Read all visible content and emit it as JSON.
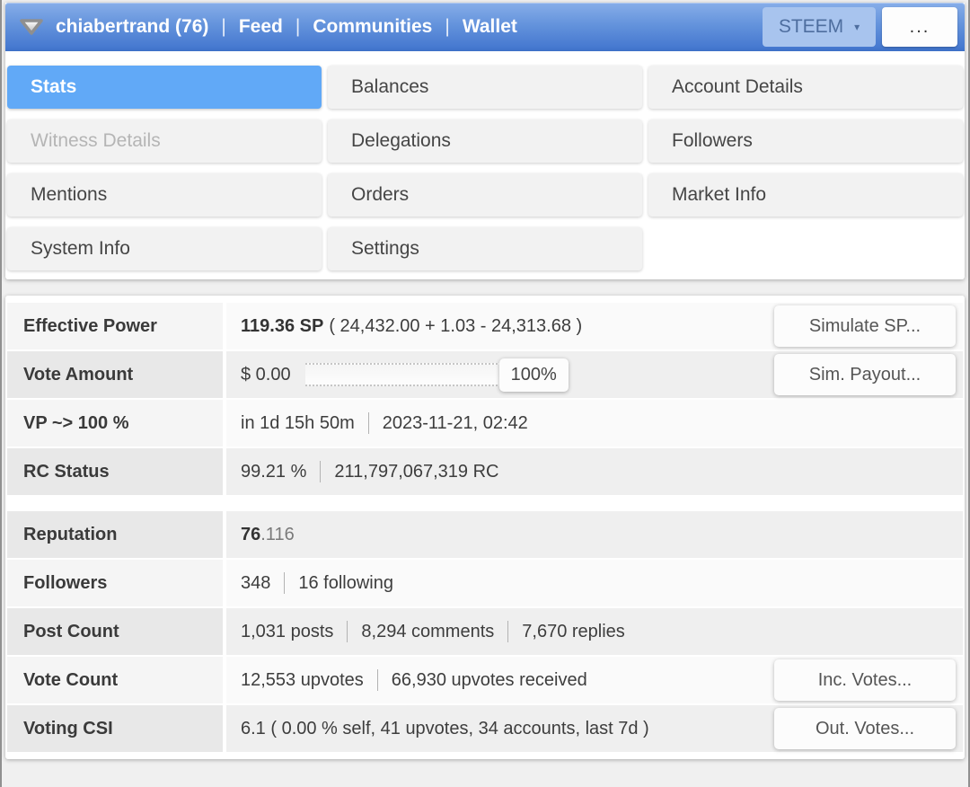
{
  "header": {
    "account": "chiabertrand (76)",
    "separator": "|",
    "nav": [
      {
        "label": "Feed"
      },
      {
        "label": "Communities"
      },
      {
        "label": "Wallet"
      }
    ],
    "currency": {
      "label": "STEEM",
      "caret": "▾"
    },
    "more_label": "..."
  },
  "tabs": [
    {
      "label": "Stats",
      "state": "active"
    },
    {
      "label": "Balances",
      "state": "normal"
    },
    {
      "label": "Account Details",
      "state": "normal"
    },
    {
      "label": "Witness Details",
      "state": "disabled"
    },
    {
      "label": "Delegations",
      "state": "normal"
    },
    {
      "label": "Followers",
      "state": "normal"
    },
    {
      "label": "Mentions",
      "state": "normal"
    },
    {
      "label": "Orders",
      "state": "normal"
    },
    {
      "label": "Market Info",
      "state": "normal"
    },
    {
      "label": "System Info",
      "state": "normal"
    },
    {
      "label": "Settings",
      "state": "normal"
    }
  ],
  "rows": [
    {
      "label": "Effective Power",
      "bold": "119.36 SP",
      "rest": "( 24,432.00 + 1.03 - 24,313.68 )",
      "button": "Simulate SP..."
    },
    {
      "label": "Vote Amount",
      "value": "$ 0.00",
      "percent": "100%",
      "button": "Sim. Payout..."
    },
    {
      "label": "VP ~> 100 %",
      "part1": "in 1d 15h 50m",
      "part2": "2023-11-21, 02:42"
    },
    {
      "label": "RC Status",
      "part1": "99.21 %",
      "part2": "211,797,067,319 RC"
    },
    {
      "label": "Reputation",
      "bold": "76",
      "rest": ".116"
    },
    {
      "label": "Followers",
      "part1": "348",
      "part2": "16 following"
    },
    {
      "label": "Post Count",
      "part1": "1,031 posts",
      "part2": "8,294 comments",
      "part3": "7,670 replies"
    },
    {
      "label": "Vote Count",
      "part1": "12,553 upvotes",
      "part2": "66,930 upvotes received",
      "button": "Inc. Votes..."
    },
    {
      "label": "Voting CSI",
      "value": "6.1 ( 0.00 % self, 41 upvotes, 34 accounts, last 7d )",
      "button": "Out. Votes..."
    }
  ],
  "colors": {
    "accent": "#61a9f7",
    "header_top": "#87aee9",
    "header_bottom": "#3d70c6",
    "dropdown_bg": "#a8c4ee"
  }
}
